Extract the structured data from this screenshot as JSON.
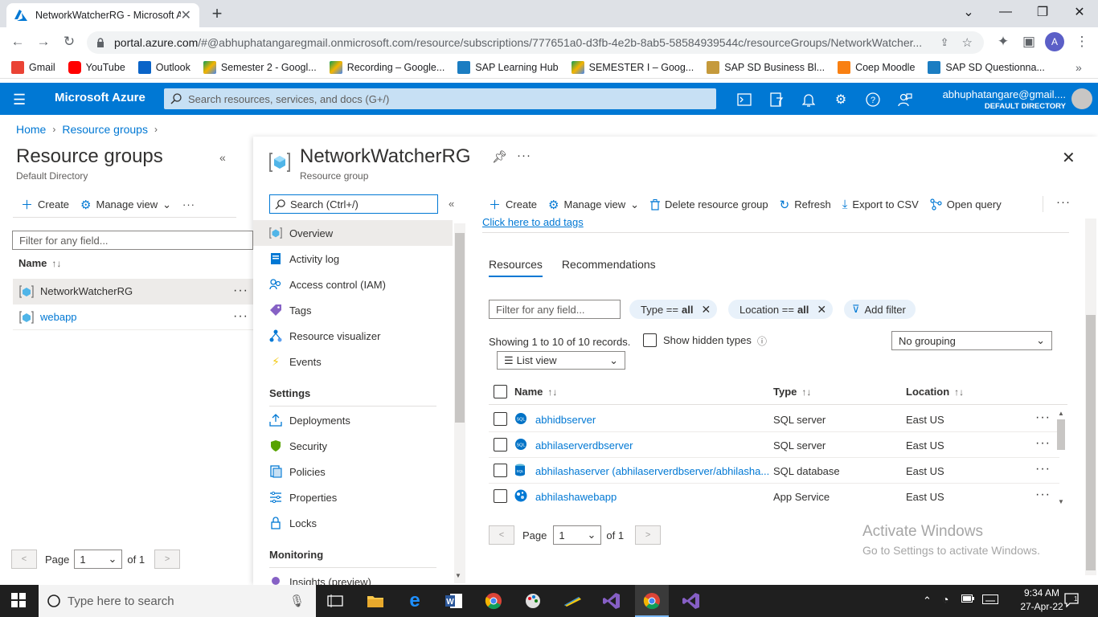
{
  "browser": {
    "tab_title": "NetworkWatcherRG - Microsoft A",
    "url_host": "portal.azure.com",
    "url_rest": "/#@abhuphatangaregmail.onmicrosoft.com/resource/subscriptions/777651a0-d3fb-4e2b-8ab5-58584939544c/resourceGroups/NetworkWatcher...",
    "profile_initial": "A",
    "bookmarks": [
      "Gmail",
      "YouTube",
      "Outlook",
      "Semester 2 - Googl...",
      "Recording – Google...",
      "SAP Learning Hub",
      "SEMESTER I – Goog...",
      "SAP SD Business Bl...",
      "Coep Moodle",
      "SAP SD Questionna..."
    ]
  },
  "azure": {
    "brand": "Microsoft Azure",
    "search_placeholder": "Search resources, services, and docs (G+/)",
    "user_email": "abhuphatangare@gmail....",
    "user_directory": "DEFAULT DIRECTORY"
  },
  "breadcrumb": [
    "Home",
    "Resource groups"
  ],
  "left_pane": {
    "title": "Resource groups",
    "subtitle": "Default Directory",
    "toolbar": {
      "create": "Create",
      "manage_view": "Manage view"
    },
    "filter_placeholder": "Filter for any field...",
    "name_header": "Name",
    "rows": [
      "NetworkWatcherRG",
      "webapp"
    ],
    "pager": {
      "page_label": "Page",
      "page_value": "1",
      "of_label": "of 1"
    }
  },
  "blade": {
    "title": "NetworkWatcherRG",
    "subtitle": "Resource group",
    "menu_search": "Search (Ctrl+/)",
    "menu_items": [
      "Overview",
      "Activity log",
      "Access control (IAM)",
      "Tags",
      "Resource visualizer",
      "Events"
    ],
    "settings_heading": "Settings",
    "settings_items": [
      "Deployments",
      "Security",
      "Policies",
      "Properties",
      "Locks"
    ],
    "monitoring_heading": "Monitoring",
    "monitoring_items": [
      "Insights (preview)"
    ],
    "toolbar": {
      "create": "Create",
      "manage_view": "Manage view",
      "delete": "Delete resource group",
      "refresh": "Refresh",
      "export": "Export to CSV",
      "open_query": "Open query"
    },
    "add_tags": "Click here to add tags",
    "tabs": [
      "Resources",
      "Recommendations"
    ],
    "filter_placeholder": "Filter for any field...",
    "pills": [
      {
        "label": "Type ==",
        "value": "all"
      },
      {
        "label": "Location ==",
        "value": "all"
      }
    ],
    "add_filter": "Add filter",
    "showing": "Showing 1 to 10 of 10 records.",
    "show_hidden": "Show hidden types",
    "grouping": "No grouping",
    "list_view": "List view",
    "columns": {
      "name": "Name",
      "type": "Type",
      "location": "Location"
    },
    "rows": [
      {
        "name": "abhidbserver",
        "type": "SQL server",
        "location": "East US"
      },
      {
        "name": "abhilaserverdbserver",
        "type": "SQL server",
        "location": "East US"
      },
      {
        "name": "abhilashaserver (abhilaserverdbserver/abhilasha...",
        "type": "SQL database",
        "location": "East US"
      },
      {
        "name": "abhilashawebapp",
        "type": "App Service",
        "location": "East US"
      }
    ],
    "pager": {
      "page_label": "Page",
      "page_value": "1",
      "of_label": "of 1"
    }
  },
  "watermark": {
    "line1": "Activate Windows",
    "line2": "Go to Settings to activate Windows."
  },
  "taskbar": {
    "search_placeholder": "Type here to search",
    "time": "9:34 AM",
    "date": "27-Apr-22"
  }
}
